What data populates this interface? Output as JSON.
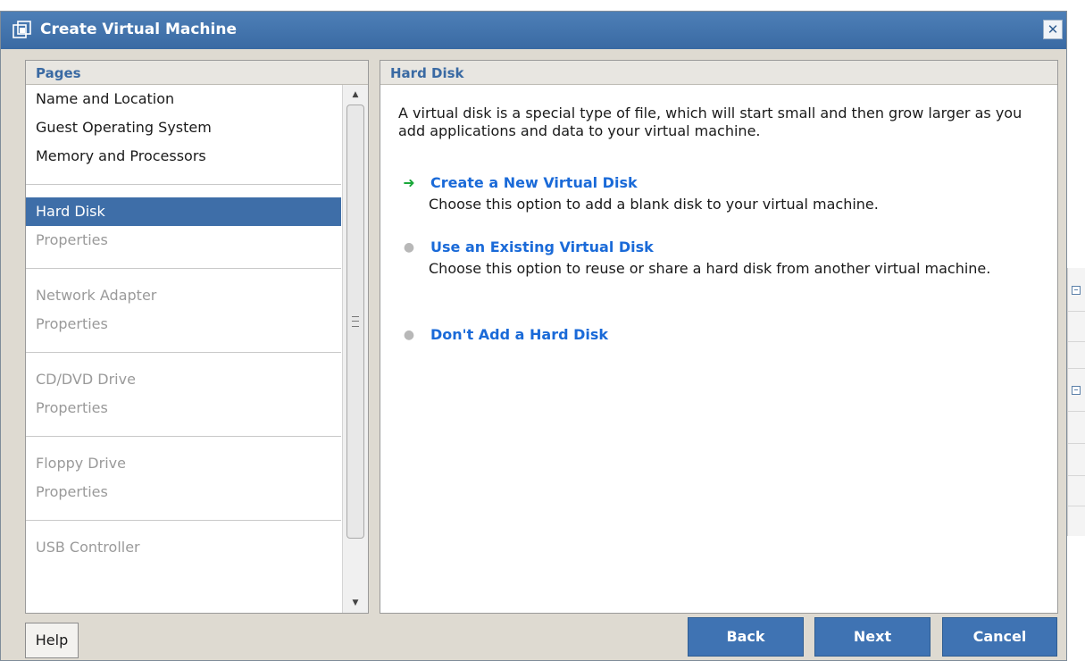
{
  "dialog": {
    "title": "Create Virtual Machine",
    "close_label": "✕"
  },
  "pages": {
    "header": "Pages",
    "groups": [
      {
        "items": [
          {
            "label": "Name and Location",
            "state": "normal"
          },
          {
            "label": "Guest Operating System",
            "state": "normal"
          },
          {
            "label": "Memory and Processors",
            "state": "normal"
          }
        ]
      },
      {
        "items": [
          {
            "label": "Hard Disk",
            "state": "selected"
          },
          {
            "label": "Properties",
            "state": "disabled"
          }
        ]
      },
      {
        "items": [
          {
            "label": "Network Adapter",
            "state": "disabled"
          },
          {
            "label": "Properties",
            "state": "disabled"
          }
        ]
      },
      {
        "items": [
          {
            "label": "CD/DVD Drive",
            "state": "disabled"
          },
          {
            "label": "Properties",
            "state": "disabled"
          }
        ]
      },
      {
        "items": [
          {
            "label": "Floppy Drive",
            "state": "disabled"
          },
          {
            "label": "Properties",
            "state": "disabled"
          }
        ]
      },
      {
        "items": [
          {
            "label": "USB Controller",
            "state": "disabled"
          }
        ]
      }
    ]
  },
  "content": {
    "header": "Hard Disk",
    "intro": "A virtual disk is a special type of file, which will start small and then grow larger as you add applications and data to your virtual machine.",
    "options": [
      {
        "title": "Create a New Virtual Disk",
        "description": "Choose this option to add a blank disk to your virtual machine.",
        "marker": "arrow-right-icon",
        "selected": true
      },
      {
        "title": "Use an Existing Virtual Disk",
        "description": "Choose this option to reuse or share a hard disk from another virtual machine.",
        "marker": "bullet-icon",
        "selected": false
      },
      {
        "title": "Don't Add a Hard Disk",
        "description": "",
        "marker": "bullet-icon",
        "selected": false
      }
    ]
  },
  "footer": {
    "help_label": "Help",
    "back_label": "Back",
    "next_label": "Next",
    "cancel_label": "Cancel"
  },
  "colors": {
    "title_bar": "#3a6aa3",
    "selection": "#3e6ea8",
    "link": "#1a6ad8",
    "arrow": "#1aa83a",
    "primary_button": "#3f73b3"
  }
}
